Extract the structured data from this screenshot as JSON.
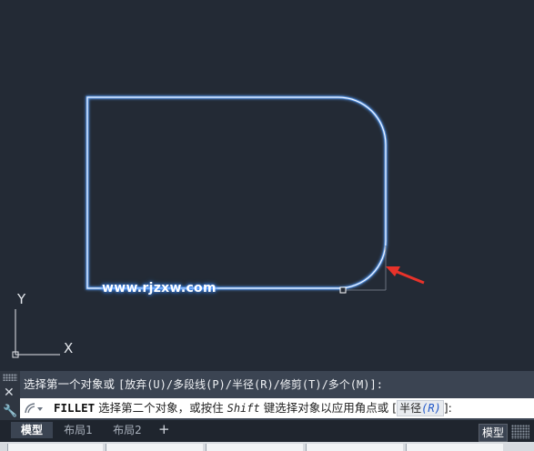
{
  "drawing": {
    "watermark": "www.rjzxw.com",
    "ucs_axes": {
      "x_label": "X",
      "y_label": "Y"
    }
  },
  "command_line": {
    "history": {
      "prefix": "选择第一个对象或 ",
      "options": "[放弃(U)/多段线(P)/半径(R)/修剪(T)/多个(M)]:"
    },
    "prompt": {
      "command": "FILLET",
      "text": " 选择第二个对象，或按住 ",
      "key": "Shift",
      "text2": " 键选择对象以应用角点或 ",
      "bracket_open": "[",
      "option_label": "半径",
      "option_key": "(R)",
      "bracket_close": "]:"
    },
    "icons": {
      "close": "close-icon",
      "customize": "wrench-icon",
      "prompt": "command-prompt-icon"
    }
  },
  "layout_tabs": [
    {
      "label": "模型",
      "active": true
    },
    {
      "label": "布局1",
      "active": false
    },
    {
      "label": "布局2",
      "active": false
    }
  ],
  "add_tab_label": "+",
  "status_bar": {
    "space": "模型"
  },
  "colors": {
    "background": "#232a35",
    "geometry": "#e8f0ff",
    "glow": "#3b8bff",
    "arrow": "#e8322a"
  }
}
